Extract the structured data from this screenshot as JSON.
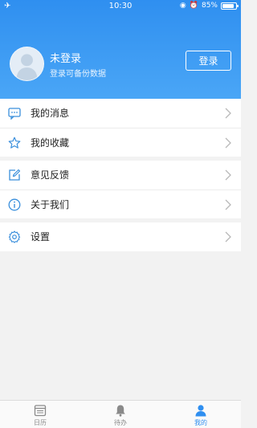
{
  "status_bar": {
    "time": "10:30",
    "battery": "85%",
    "battery_level": 0.85
  },
  "profile": {
    "name": "未登录",
    "subtitle": "登录可备份数据",
    "login_button": "登录"
  },
  "menu_groups": [
    [
      {
        "icon": "message-icon",
        "label": "我的消息"
      },
      {
        "icon": "star-icon",
        "label": "我的收藏"
      }
    ],
    [
      {
        "icon": "edit-icon",
        "label": "意见反馈"
      },
      {
        "icon": "info-icon",
        "label": "关于我们"
      }
    ],
    [
      {
        "icon": "gear-icon",
        "label": "设置"
      }
    ]
  ],
  "tabs": [
    {
      "icon": "calendar-icon",
      "label": "日历",
      "active": false
    },
    {
      "icon": "bell-icon",
      "label": "待办",
      "active": false
    },
    {
      "icon": "person-icon",
      "label": "我的",
      "active": true
    }
  ],
  "colors": {
    "accent": "#2f8ff0",
    "icon": "#3a8fdc",
    "background": "#f2f2f2"
  }
}
